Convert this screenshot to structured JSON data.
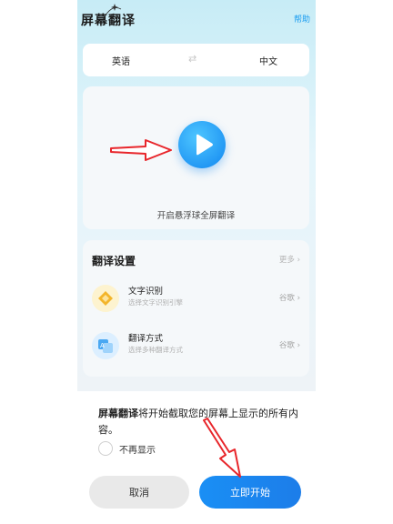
{
  "header": {
    "title": "屏幕翻译",
    "help_label": "帮助"
  },
  "language_bar": {
    "source": "英语",
    "swap_icon": "⇄",
    "target": "中文"
  },
  "floating_ball": {
    "label": "开启悬浮球全屏翻译"
  },
  "settings": {
    "title": "翻译设置",
    "more_label": "更多 ›",
    "items": [
      {
        "name": "文字识别",
        "description": "选择文字识别引擎",
        "value": "谷歌 ›",
        "icon": "text-recognition-icon"
      },
      {
        "name": "翻译方式",
        "description": "选择多种翻译方式",
        "value": "谷歌 ›",
        "icon": "translation-method-icon"
      }
    ]
  },
  "dialog": {
    "message_bold": "屏幕翻译",
    "message_rest": "将开始截取您的屏幕上显示的所有内容。",
    "checkbox_label": "不再显示",
    "cancel_label": "取消",
    "start_label": "立即开始"
  },
  "colors": {
    "accent": "#1a8ff5",
    "annotation_arrow": "#e8262b"
  }
}
